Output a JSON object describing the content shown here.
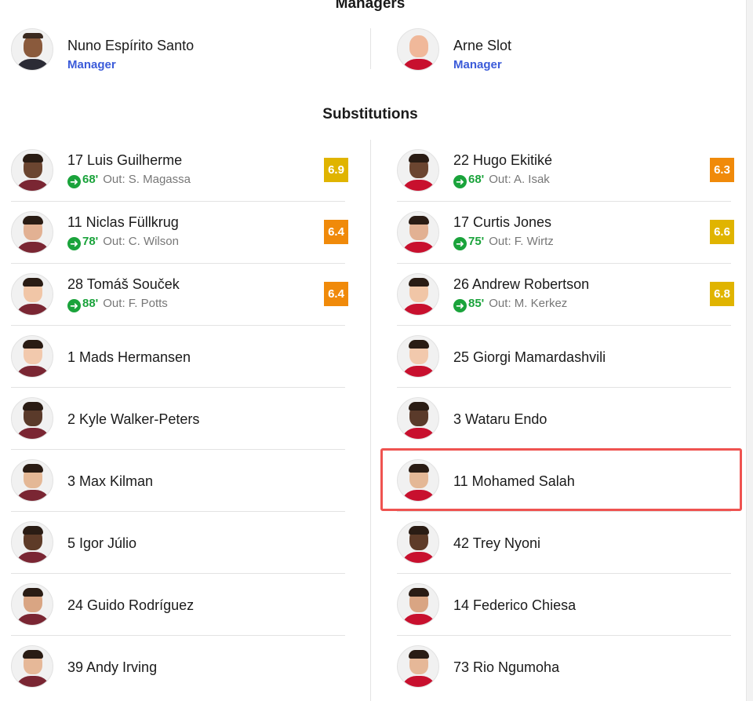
{
  "managers": {
    "title": "Managers",
    "home": {
      "name": "Nuno Espírito Santo",
      "role": "Manager"
    },
    "away": {
      "name": "Arne Slot",
      "role": "Manager"
    }
  },
  "substitutions": {
    "title": "Substitutions",
    "home": [
      {
        "label": "17 Luis Guilherme",
        "minute": "68'",
        "out": "Out:  S. Magassa",
        "rating": "6.9",
        "rating_color": "#e0b400"
      },
      {
        "label": "11 Niclas Füllkrug",
        "minute": "78'",
        "out": "Out:  C. Wilson",
        "rating": "6.4",
        "rating_color": "#f08a0a"
      },
      {
        "label": "28 Tomáš Souček",
        "minute": "88'",
        "out": "Out:  F. Potts",
        "rating": "6.4",
        "rating_color": "#f08a0a"
      },
      {
        "label": "1 Mads Hermansen"
      },
      {
        "label": "2 Kyle Walker-Peters"
      },
      {
        "label": "3 Max Kilman"
      },
      {
        "label": "5 Igor Júlio"
      },
      {
        "label": "24 Guido Rodríguez"
      },
      {
        "label": "39 Andy Irving"
      }
    ],
    "away": [
      {
        "label": "22 Hugo Ekitiké",
        "minute": "68'",
        "out": "Out:  A. Isak",
        "rating": "6.3",
        "rating_color": "#f08a0a"
      },
      {
        "label": "17 Curtis Jones",
        "minute": "75'",
        "out": "Out:  F. Wirtz",
        "rating": "6.6",
        "rating_color": "#e0b400"
      },
      {
        "label": "26 Andrew Robertson",
        "minute": "85'",
        "out": "Out:  M. Kerkez",
        "rating": "6.8",
        "rating_color": "#e0b400"
      },
      {
        "label": "25 Giorgi Mamardashvili"
      },
      {
        "label": "3 Wataru Endo"
      },
      {
        "label": "11 Mohamed Salah"
      },
      {
        "label": "42 Trey Nyoni"
      },
      {
        "label": "14 Federico Chiesa"
      },
      {
        "label": "73 Rio Ngumoha"
      }
    ]
  },
  "colors": {
    "accent": "#3b5bd9",
    "sub_green": "#1aa33b",
    "highlight": "#ef5350",
    "home_shirt": "#7a2633",
    "away_shirt": "#c8102e"
  },
  "icons": {
    "sub_in": "arrow-right-circle-icon"
  }
}
